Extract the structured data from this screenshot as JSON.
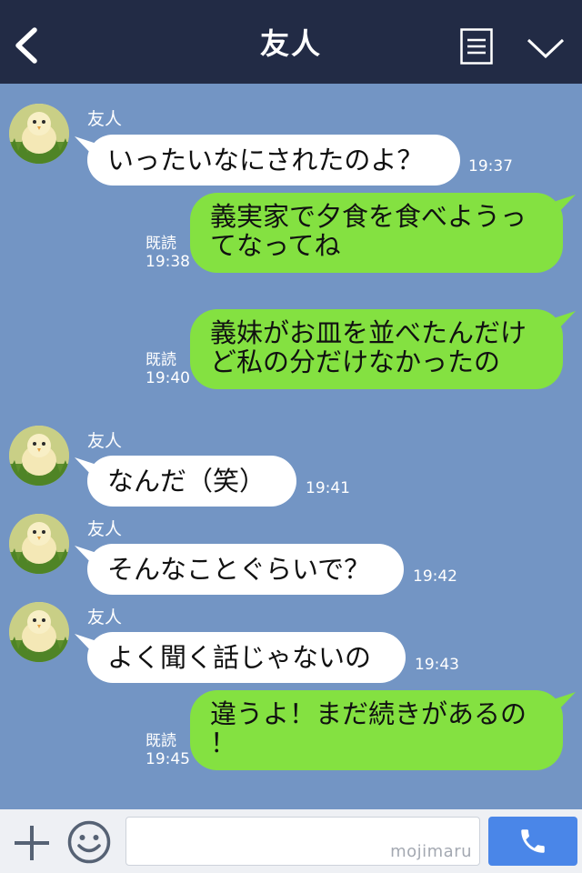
{
  "header": {
    "title": "友人"
  },
  "messages": [
    {
      "direction": "in",
      "sender": "友人",
      "lines": [
        "いったいなにされたのよ？"
      ],
      "time": "19:37"
    },
    {
      "direction": "out",
      "read": "既読",
      "lines": [
        "義実家で夕食を食べようっ",
        "てなってね"
      ],
      "time": "19:38"
    },
    {
      "direction": "out",
      "read": "既読",
      "lines": [
        "義妹がお皿を並べたんだけ",
        "ど私の分だけなかったの"
      ],
      "time": "19:40"
    },
    {
      "direction": "in",
      "sender": "友人",
      "lines": [
        "なんだ（笑）"
      ],
      "time": "19:41"
    },
    {
      "direction": "in",
      "sender": "友人",
      "lines": [
        "そんなことぐらいで？"
      ],
      "time": "19:42"
    },
    {
      "direction": "in",
      "sender": "友人",
      "lines": [
        "よく聞く話じゃないの"
      ],
      "time": "19:43"
    },
    {
      "direction": "out",
      "read": "既読",
      "lines": [
        "違うよ！まだ続きがあるの",
        "！"
      ],
      "time": "19:45"
    }
  ],
  "footer": {
    "input_value": "",
    "watermark": "mojimaru"
  },
  "icons": {
    "back": "chevron-left-icon",
    "menu": "document-list-icon",
    "dropdown": "chevron-down-icon",
    "add": "plus-icon",
    "emoji": "smiley-icon",
    "call": "phone-icon",
    "avatar": "chick-avatar"
  },
  "colors": {
    "header_bg": "#222b45",
    "chat_bg": "#7395c4",
    "incoming_bubble": "#ffffff",
    "outgoing_bubble": "#84e141",
    "call_button": "#4a86e8"
  }
}
